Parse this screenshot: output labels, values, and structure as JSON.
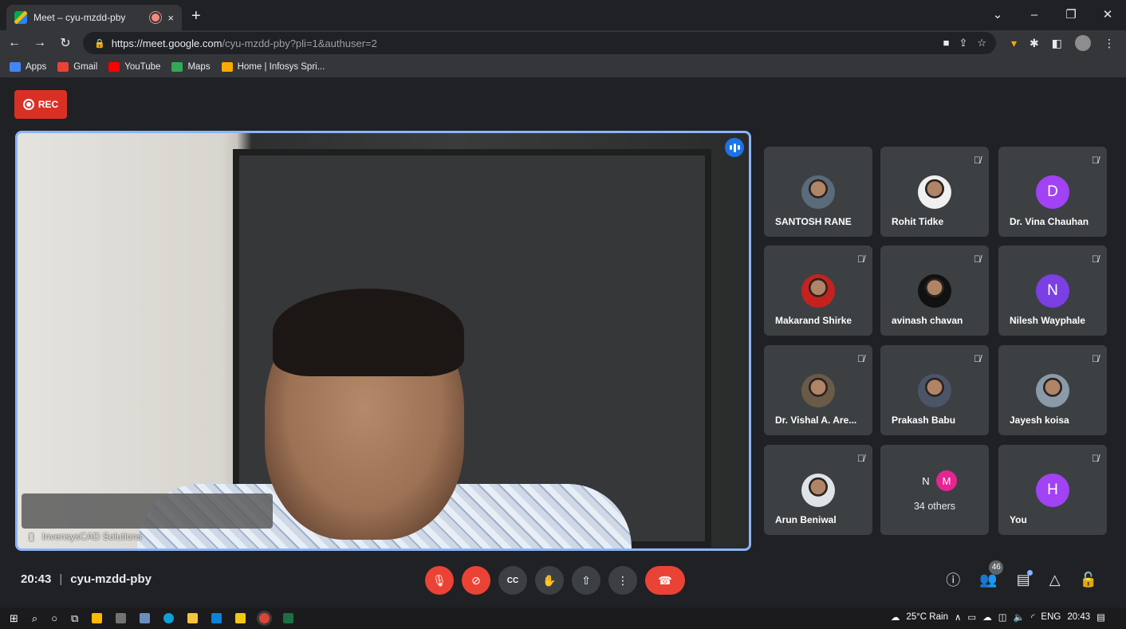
{
  "browser": {
    "tab_title": "Meet – cyu-mzdd-pby",
    "tab_close": "×",
    "new_tab": "+",
    "url_host": "https://meet.google.com",
    "url_path": "/cyu-mzdd-pby?pli=1&authuser=2",
    "bookmarks": [
      {
        "label": "Apps",
        "icon": "apps-grid-icon",
        "color": "#4285f4"
      },
      {
        "label": "Gmail",
        "icon": "gmail-icon",
        "color": "#ea4335"
      },
      {
        "label": "YouTube",
        "icon": "youtube-icon",
        "color": "#ff0000"
      },
      {
        "label": "Maps",
        "icon": "maps-icon",
        "color": "#34a853"
      },
      {
        "label": "Home | Infosys Spri...",
        "icon": "infosys-icon",
        "color": "#f9ab00"
      }
    ]
  },
  "meet": {
    "rec_label": "REC",
    "main_speaker": "InvensysCAD Solutions",
    "time": "20:43",
    "meeting_code": "cyu-mzdd-pby",
    "people_count": "46",
    "participants": [
      {
        "name": "SANTOSH RANE",
        "type": "photo",
        "muted": false,
        "color": "#5a6b7a"
      },
      {
        "name": "Rohit Tidke",
        "type": "photo",
        "muted": true,
        "color": "#f0f0f0"
      },
      {
        "name": "Dr. Vina Chauhan",
        "type": "letter",
        "letter": "D",
        "muted": true,
        "color": "#a142f4"
      },
      {
        "name": "Makarand Shirke",
        "type": "photo",
        "muted": true,
        "color": "#c5221f"
      },
      {
        "name": "avinash chavan",
        "type": "photo",
        "muted": true,
        "color": "#111111"
      },
      {
        "name": "Nilesh Wayphale",
        "type": "letter",
        "letter": "N",
        "muted": true,
        "color": "#7b3fe4"
      },
      {
        "name": "Dr. Vishal A. Are...",
        "type": "photo",
        "muted": true,
        "color": "#6b5a48"
      },
      {
        "name": "Prakash Babu",
        "type": "photo",
        "muted": true,
        "color": "#4a5568"
      },
      {
        "name": "Jayesh koisa",
        "type": "photo",
        "muted": true,
        "color": "#8a9aa8"
      },
      {
        "name": "Arun Beniwal",
        "type": "photo",
        "muted": true,
        "color": "#dfe3e8"
      },
      {
        "name": "34 others",
        "type": "others",
        "muted": false,
        "letters": [
          "N",
          "M"
        ],
        "colors": [
          "#3c4043",
          "#e52592"
        ]
      },
      {
        "name": "You",
        "type": "letter",
        "letter": "H",
        "muted": true,
        "color": "#a142f4"
      }
    ]
  },
  "taskbar": {
    "weather": "25°C Rain",
    "lang": "ENG",
    "clock": "20:43"
  }
}
